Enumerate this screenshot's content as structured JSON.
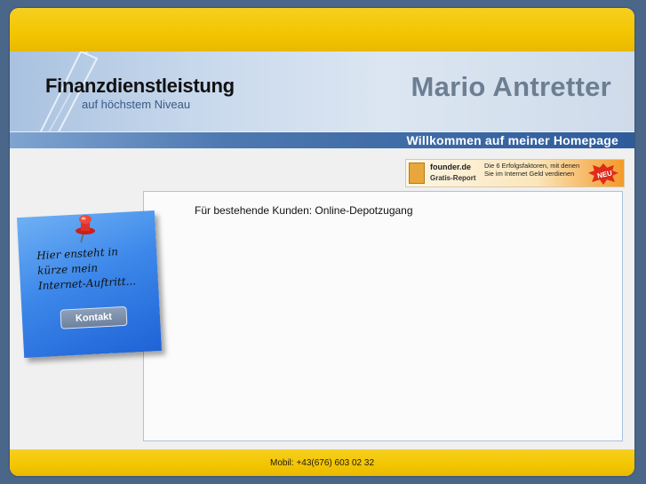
{
  "header": {
    "title": "Finanzdienstleistung",
    "subtitle": "auf höchstem Niveau",
    "owner": "Mario Antretter"
  },
  "welcome": "Willkommen auf meiner Homepage",
  "banner": {
    "brand": "founder.de",
    "report": "Gratis-Report",
    "description": "Die 6 Erfolgsfaktoren, mit denen Sie im Internet Geld verdienen",
    "badge": "NEU"
  },
  "content": {
    "line": "Für bestehende Kunden: Online-Depotzugang"
  },
  "note": {
    "line1": "Hier ensteht in",
    "line2": "kürze mein",
    "line3": "Internet-Auftritt...",
    "button": "Kontakt"
  },
  "footer": {
    "text": "Mobil: +43(676) 603 02 32"
  },
  "colors": {
    "accent": "#f3c500",
    "background": "#4a6688",
    "note": "#3d88ea"
  }
}
